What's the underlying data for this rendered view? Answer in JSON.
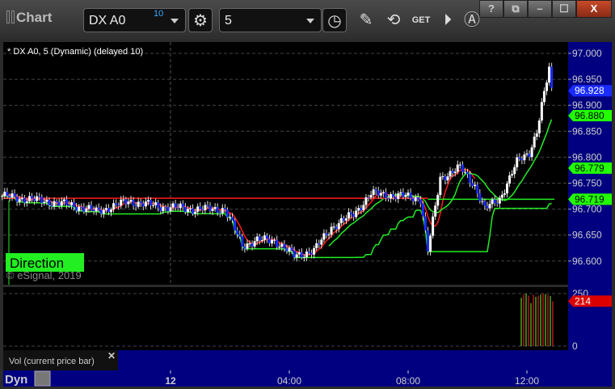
{
  "window": {
    "title": "Chart",
    "buttons": [
      "?",
      "⧉",
      "–",
      "☐",
      "X"
    ]
  },
  "toolbar": {
    "symbol": "DX A0",
    "symbol_badge": "10",
    "interval": "5",
    "icons": [
      "settings-gear-icon",
      "clock-icon",
      "pencil-icon",
      "study-icon",
      "get-icon",
      "play-icon",
      "alert-icon"
    ],
    "get_label": "GET"
  },
  "chart": {
    "legend": "* DX A0, 5 (Dynamic) (delayed 10)",
    "watermark": "© eSignal, 2019",
    "direction_label": "Direction",
    "vol_label": "Vol (current price bar)",
    "dyn_label": "Dyn",
    "colors": {
      "up": "#ffffff",
      "down": "#1a2cff",
      "ma_red": "#ff1a1a",
      "ma_green": "#22ee22",
      "axis_bg": "#000080",
      "price_tag": "#1a2cff",
      "green_tag": "#22ff00",
      "vol_tag": "#dd0000"
    },
    "price_ticks": [
      "97.000",
      "96.950",
      "96.900",
      "96.850",
      "96.800",
      "96.750",
      "96.700",
      "96.650",
      "96.600"
    ],
    "price_tags": {
      "last": "96.928",
      "ma_fast": "96.880",
      "ma_slow": "96.779",
      "level": "96.719"
    },
    "vol_ticks": [
      "250",
      "0"
    ],
    "vol_tag": "214",
    "time_ticks": [
      "12",
      "04:00",
      "08:00",
      "12:00"
    ]
  },
  "chart_data": {
    "type": "candlestick",
    "yrange": [
      96.58,
      97.02
    ],
    "close_path": [
      [
        "11 18:20",
        96.725
      ],
      [
        "11 19:50",
        96.715
      ],
      [
        "11 20:55",
        96.705
      ],
      [
        "11 21:30",
        96.695
      ],
      [
        "11 22:35",
        96.715
      ],
      [
        "11 23:40",
        96.705
      ],
      [
        "12 00:45",
        96.7
      ],
      [
        "12 01:50",
        96.7
      ],
      [
        "12 02:25",
        96.63
      ],
      [
        "12 02:55",
        96.64
      ],
      [
        "12 03:30",
        96.64
      ],
      [
        "12 04:10",
        96.61
      ],
      [
        "12 04:50",
        96.62
      ],
      [
        "12 05:25",
        96.665
      ],
      [
        "12 06:10",
        96.69
      ],
      [
        "12 06:45",
        96.73
      ],
      [
        "12 07:50",
        96.725
      ],
      [
        "12 08:25",
        96.72
      ],
      [
        "12 08:40",
        96.62
      ],
      [
        "12 09:05",
        96.76
      ],
      [
        "12 09:45",
        96.78
      ],
      [
        "12 10:15",
        96.745
      ],
      [
        "12 10:35",
        96.7
      ],
      [
        "12 11:05",
        96.72
      ],
      [
        "12 11:40",
        96.79
      ],
      [
        "12 12:05",
        96.81
      ],
      [
        "12 12:20",
        96.85
      ],
      [
        "12 12:45",
        96.97
      ],
      [
        "12 12:50",
        96.928
      ]
    ],
    "levels": {
      "red": 96.721,
      "green": 96.719
    },
    "volume": [
      230,
      245,
      250,
      240,
      205,
      245,
      235,
      240,
      245,
      250,
      248,
      244,
      238,
      214
    ]
  }
}
